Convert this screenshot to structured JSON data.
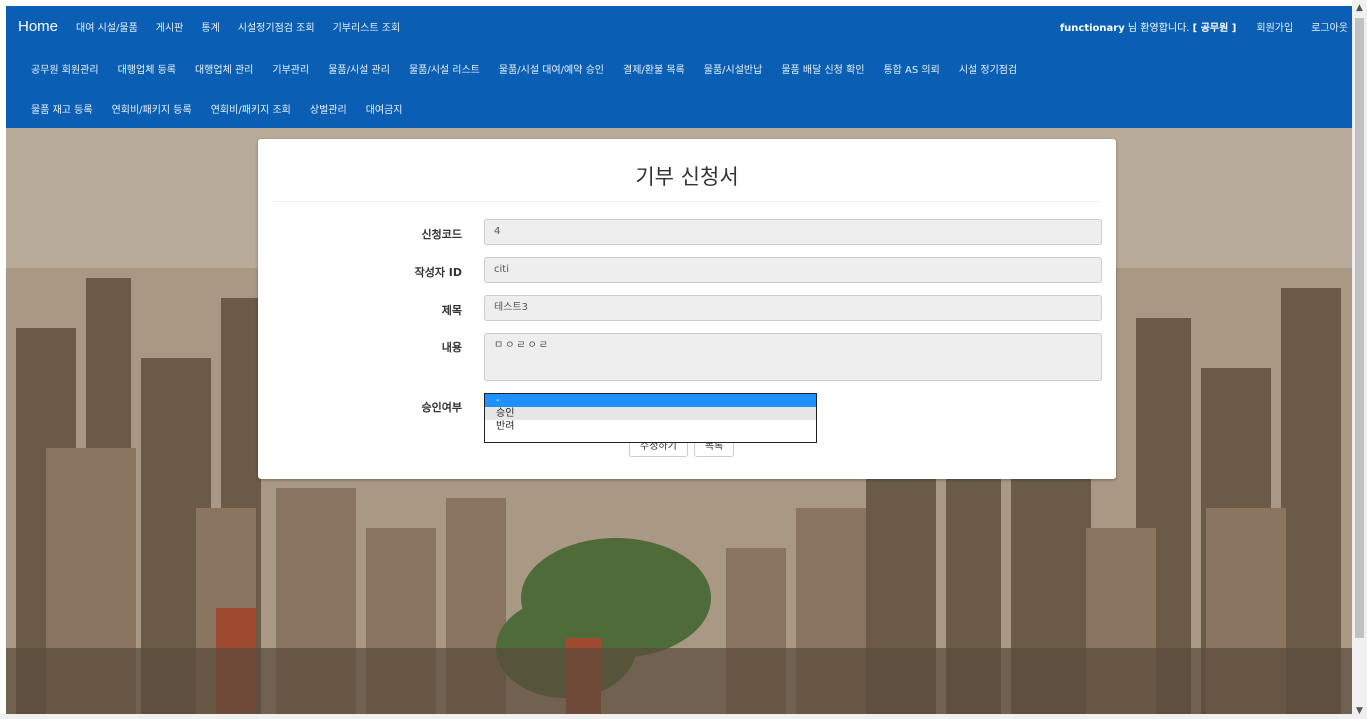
{
  "nav": {
    "home": "Home",
    "row1": [
      "대여 시설/물품",
      "게시판",
      "통계",
      "시설정기점검 조회",
      "기부리스트 조회"
    ],
    "welcome_user": "functionary",
    "welcome_text": " 님 환영합니다. ",
    "welcome_role": "[ 공무원 ]",
    "signup": "회원가입",
    "logout": "로그아웃",
    "row2": [
      "공무원 회원관리",
      "대행업체 등록",
      "대행업체 관리",
      "기부관리",
      "물품/시설 관리",
      "물품/시설 리스트",
      "물품/시설 대여/예약 승인",
      "결제/환불 목록",
      "물품/시설반납",
      "물품 배달 신청 확인",
      "통합 AS 의뢰",
      "시설 정기점검"
    ],
    "row3": [
      "물품 재고 등록",
      "연회비/패키지 등록",
      "연회비/패키지 조회",
      "상벌관리",
      "대여금지"
    ]
  },
  "form": {
    "title": "기부 신청서",
    "code_label": "신청코드",
    "code_value": "4",
    "author_label": "작성자 ID",
    "author_value": "citi",
    "subject_label": "제목",
    "subject_value": "테스트3",
    "content_label": "내용",
    "content_value": "ㅁㅇㄹㅇㄹ",
    "approval_label": "승인여부",
    "approval_options": [
      "-",
      "승인",
      "반려"
    ],
    "edit_button": "수정하기",
    "list_button": "목록"
  },
  "colors": {
    "navbar": "#0a5fb4",
    "selected_option": "#1e90ff"
  }
}
